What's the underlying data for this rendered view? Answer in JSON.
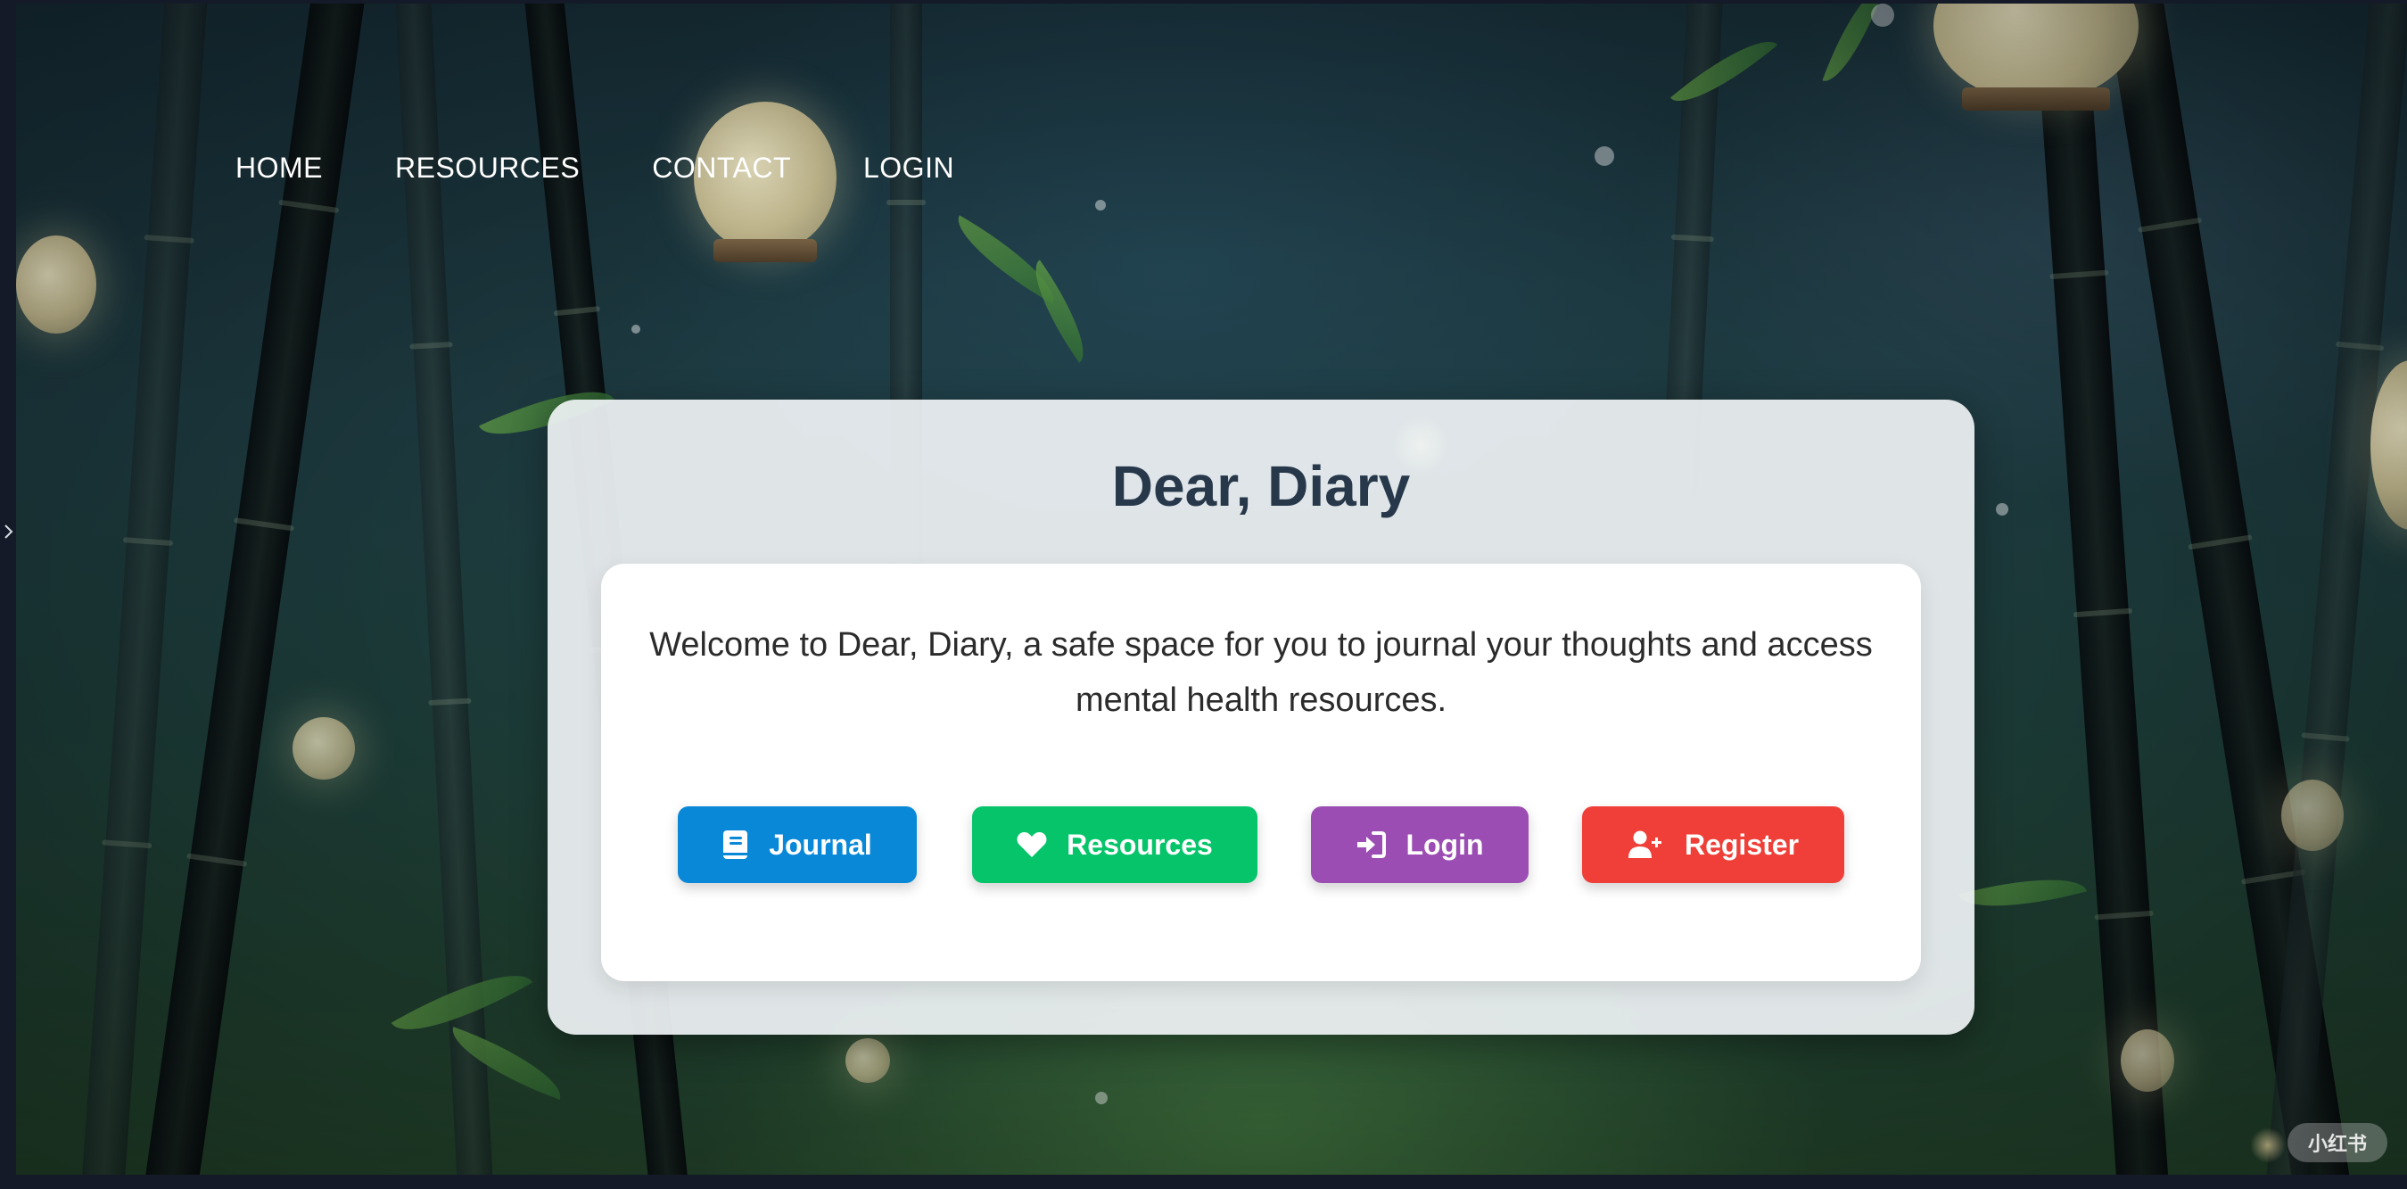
{
  "nav": {
    "items": [
      {
        "label": "HOME"
      },
      {
        "label": "RESOURCES"
      },
      {
        "label": "CONTACT"
      },
      {
        "label": "LOGIN"
      }
    ]
  },
  "card": {
    "title": "Dear, Diary",
    "welcome_text": "Welcome to Dear, Diary, a safe space for you to journal your thoughts and access mental health resources."
  },
  "buttons": [
    {
      "label": "Journal",
      "icon": "book-icon",
      "color": "#0a88d8"
    },
    {
      "label": "Resources",
      "icon": "heart-icon",
      "color": "#05c46a"
    },
    {
      "label": "Login",
      "icon": "sign-in-icon",
      "color": "#9b4db3"
    },
    {
      "label": "Register",
      "icon": "user-plus-icon",
      "color": "#ef3f38"
    }
  ],
  "watermark": {
    "text": "小红书"
  },
  "colors": {
    "card_title": "#27384b",
    "card_background": "#eef2f4",
    "inner_background": "#ffffff"
  }
}
